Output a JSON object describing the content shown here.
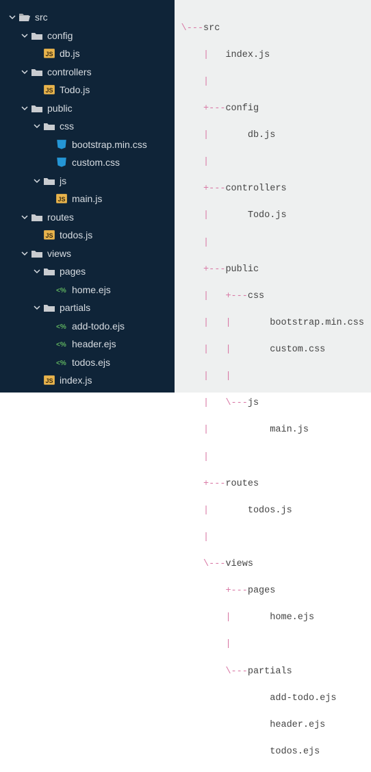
{
  "tree": {
    "src": "src",
    "config": "config",
    "db_js": "db.js",
    "controllers": "controllers",
    "todo_js": "Todo.js",
    "public": "public",
    "css": "css",
    "bootstrap": "bootstrap.min.css",
    "custom": "custom.css",
    "js": "js",
    "main_js": "main.js",
    "routes": "routes",
    "todos_js": "todos.js",
    "views": "views",
    "pages": "pages",
    "home_ejs": "home.ejs",
    "partials": "partials",
    "add_todo_ejs": "add-todo.ejs",
    "header_ejs": "header.ejs",
    "todos_ejs": "todos.ejs",
    "index_js": "index.js"
  },
  "ascii": {
    "l0": "\\---src",
    "l1": "    |   index.js",
    "l2": "    |",
    "l3": "    +---config",
    "l4": "    |       db.js",
    "l5": "    |",
    "l6": "    +---controllers",
    "l7": "    |       Todo.js",
    "l8": "    |",
    "l9": "    +---public",
    "l10": "    |   +---css",
    "l11": "    |   |       bootstrap.min.css",
    "l12": "    |   |       custom.css",
    "l13": "    |   |",
    "l14": "    |   \\---js",
    "l15": "    |           main.js",
    "l16": "    |",
    "l17": "    +---routes",
    "l18": "    |       todos.js",
    "l19": "    |",
    "l20": "    \\---views",
    "l21": "        +---pages",
    "l22": "        |       home.ejs",
    "l23": "        |",
    "l24": "        \\---partials",
    "l25": "                add-todo.ejs",
    "l26": "                header.ejs",
    "l27": "                todos.ejs"
  }
}
